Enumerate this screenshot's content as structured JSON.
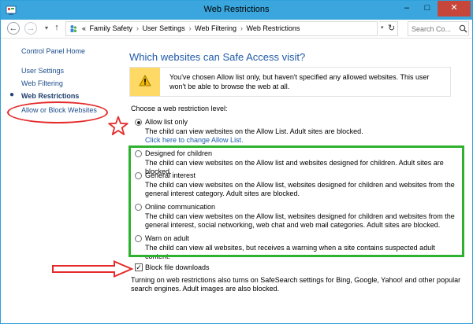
{
  "window": {
    "title": "Web Restrictions",
    "minimize": "–",
    "maximize": "□",
    "close": "✕"
  },
  "address": {
    "recent": "▾",
    "crumbs": [
      "«",
      "Family Safety",
      "User Settings",
      "Web Filtering",
      "Web Restrictions"
    ],
    "chevron": "›",
    "dropdown": "▾",
    "refresh": "↻",
    "search_placeholder": "Search Co..."
  },
  "sidebar": {
    "home": "Control Panel Home",
    "items": [
      "User Settings",
      "Web Filtering"
    ],
    "current": "Web Restrictions",
    "sub": "Allow or Block Websites"
  },
  "main": {
    "heading": "Which websites can Safe Access visit?",
    "warning": "You've chosen Allow list only, but haven't specified any allowed websites. This user won't be able to browse the web at all.",
    "level_label": "Choose a web restriction level:",
    "options": [
      {
        "title": "Allow list only",
        "desc": "The child can view websites on the Allow List. Adult sites are blocked.",
        "link": "Click here to change Allow List.",
        "checked": true
      },
      {
        "title": "Designed for children",
        "desc": "The child can view websites on the Allow list and websites designed for children. Adult sites are blocked.",
        "checked": false
      },
      {
        "title": "General interest",
        "desc": "The child can view websites on the Allow list, websites designed for children and websites from the general interest category. Adult sites are blocked.",
        "checked": false
      },
      {
        "title": "Online communication",
        "desc": "The child can view websites on the Allow list, websites designed for children and websites from the general interest, social networking, web chat and web mail categories. Adult sites are blocked.",
        "checked": false
      },
      {
        "title": "Warn on adult",
        "desc": "The child can view all websites, but receives a warning when a site contains suspected adult content.",
        "checked": false
      }
    ],
    "block_downloads": {
      "label": "Block file downloads",
      "checked": true,
      "mark": "✓"
    },
    "footer": "Turning on web restrictions also turns on SafeSearch settings for Bing, Google, Yahoo! and other popular search engines. Adult images are also blocked."
  },
  "colors": {
    "titlebar": "#3aa6dd",
    "close": "#c7463c",
    "link": "#1e4e8c",
    "heading": "#1f5aa8",
    "warning": "#ffd966",
    "annotation_red": "#e52a2a",
    "annotation_green": "#2eb12e"
  }
}
